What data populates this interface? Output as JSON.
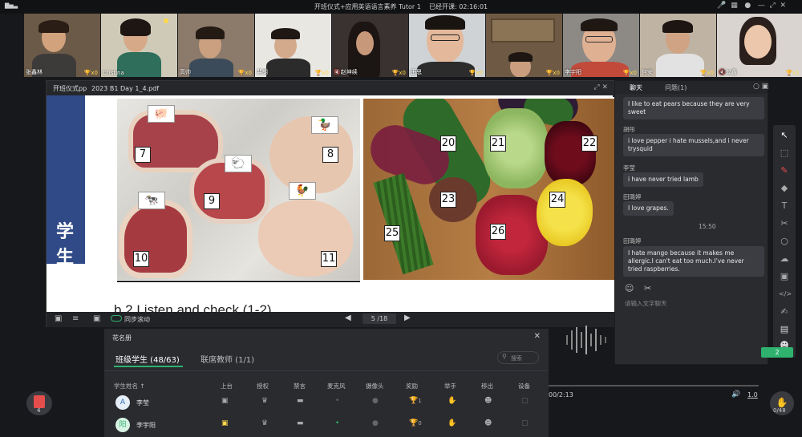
{
  "top_bar": {
    "signal": "▇▅▃",
    "title": "开班仪式+应用英语语言素养 Tutor 1",
    "timer_label": "已经开课: 02:16:01"
  },
  "participants": [
    {
      "name": "张鑫林",
      "count": "x0"
    },
    {
      "name": "Cristina",
      "count": ""
    },
    {
      "name": "高帅",
      "count": "x0"
    },
    {
      "name": "裴朗",
      "count": "x0"
    },
    {
      "name": "赵坤续",
      "count": "x0"
    },
    {
      "name": "田思",
      "count": "x0"
    },
    {
      "name": "",
      "count": "x0"
    },
    {
      "name": "李宇阳",
      "count": "x0"
    },
    {
      "name": "何安",
      "count": "x0"
    },
    {
      "name": "公鑫",
      "count": "x1"
    }
  ],
  "doc": {
    "tab_label": "开班仪式pp",
    "file_name": "2023 B1 Day 1_4.pdf",
    "side_text": "学生",
    "numbers_left": [
      "7",
      "8",
      "9",
      "10",
      "11"
    ],
    "numbers_right": [
      "20",
      "21",
      "22",
      "23",
      "24",
      "25",
      "26"
    ],
    "slide_text_partial": "b 2 Listen and check (1-2)",
    "sync_scroll": "同步滚动",
    "page_current": "5",
    "page_total": "/18"
  },
  "chat": {
    "tab_chat": "聊天",
    "tab_questions": "问题(1)",
    "messages": [
      {
        "name": "",
        "text": "I like to eat pears because they are very sweet"
      },
      {
        "name": "胡彤",
        "text": "i love pepper i hate mussels,and i never trysquid"
      },
      {
        "name": "李莹",
        "text": "i  have never tried lamb"
      },
      {
        "name": "田璐婷",
        "text": "I love grapes."
      },
      {
        "name": "田璐婷",
        "text": "I hate mango because it makes me allergic.I can't eat too much.I've never tried raspberries."
      }
    ],
    "timestamp": "15:50",
    "input_placeholder": "请输入文字聊天"
  },
  "roster": {
    "title": "花名册",
    "tab_students": "班级学生 (48/63)",
    "tab_teachers": "联席教师 (1/1)",
    "search_placeholder": "搜索",
    "columns": [
      "学生姓名 ↑",
      "上台",
      "授权",
      "禁言",
      "麦克风",
      "摄像头",
      "奖励",
      "举手",
      "移出",
      "设备"
    ],
    "rows": [
      {
        "avatar": "A",
        "name": "李莹",
        "reward": "1"
      },
      {
        "avatar": "阳",
        "name": "李宇阳",
        "reward": "0"
      }
    ]
  },
  "media": {
    "time": "00/2:13",
    "speed": "1.0",
    "badge": "2",
    "hands_count": "0/48"
  },
  "ppt_count": "4",
  "colors": {
    "accent_green": "#2fb26e",
    "doc_blue": "#2f4a86",
    "trophy": "#ffd84a"
  }
}
